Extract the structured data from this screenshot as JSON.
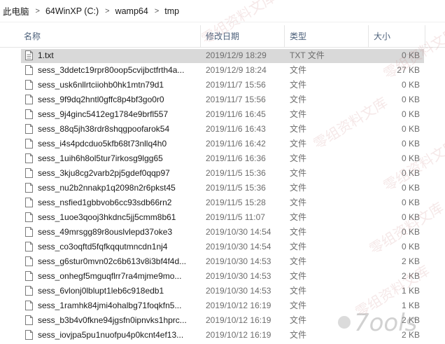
{
  "breadcrumb": [
    "此电脑",
    "64WinXP  (C:)",
    "wamp64",
    "tmp"
  ],
  "columns": {
    "name": "名称",
    "date": "修改日期",
    "type": "类型",
    "size": "大小"
  },
  "files": [
    {
      "name": "1.txt",
      "date": "2019/12/9 18:29",
      "type": "TXT 文件",
      "size": "0 KB",
      "selected": true
    },
    {
      "name": "sess_3ddetc19rpr80oop5cvijbctfrth4a...",
      "date": "2019/12/9 18:24",
      "type": "文件",
      "size": "27 KB"
    },
    {
      "name": "sess_usk6nllrtciiohb0hk1mtn79d1",
      "date": "2019/11/7 15:56",
      "type": "文件",
      "size": "0 KB"
    },
    {
      "name": "sess_9f9dq2hntl0gffc8p4bf3go0r0",
      "date": "2019/11/7 15:56",
      "type": "文件",
      "size": "0 KB"
    },
    {
      "name": "sess_9j4ginc5412eg1784e9brfl557",
      "date": "2019/11/6 16:45",
      "type": "文件",
      "size": "0 KB"
    },
    {
      "name": "sess_88q5jh38rdr8shqgpoofarok54",
      "date": "2019/11/6 16:43",
      "type": "文件",
      "size": "0 KB"
    },
    {
      "name": "sess_i4s4pdcduo5kfb68t73nllq4h0",
      "date": "2019/11/6 16:42",
      "type": "文件",
      "size": "0 KB"
    },
    {
      "name": "sess_1uih6h8ol5tur7irkosg9lgg65",
      "date": "2019/11/6 16:36",
      "type": "文件",
      "size": "0 KB"
    },
    {
      "name": "sess_3kju8cg2varb2pj5gdef0qqp97",
      "date": "2019/11/5 15:36",
      "type": "文件",
      "size": "0 KB"
    },
    {
      "name": "sess_nu2b2nnakp1q2098n2r6pkst45",
      "date": "2019/11/5 15:36",
      "type": "文件",
      "size": "0 KB"
    },
    {
      "name": "sess_nsfied1gbbvob6cc93sdb66rn2",
      "date": "2019/11/5 15:28",
      "type": "文件",
      "size": "0 KB"
    },
    {
      "name": "sess_1uoe3qooj3hkdnc5jj5cmm8b61",
      "date": "2019/11/5 11:07",
      "type": "文件",
      "size": "0 KB"
    },
    {
      "name": "sess_49mrsgg89r8ouslvlepd37oke3",
      "date": "2019/10/30 14:54",
      "type": "文件",
      "size": "0 KB"
    },
    {
      "name": "sess_co3oqftd5fqfkqqutmncdn1nj4",
      "date": "2019/10/30 14:54",
      "type": "文件",
      "size": "0 KB"
    },
    {
      "name": "sess_g6stur0mvn02c6b613v8i3bf4f4d...",
      "date": "2019/10/30 14:53",
      "type": "文件",
      "size": "2 KB"
    },
    {
      "name": "sess_onhegf5mguqflrr7ra4mjme9mo...",
      "date": "2019/10/30 14:53",
      "type": "文件",
      "size": "2 KB"
    },
    {
      "name": "sess_6vlonj0lblupt1leb6c918edb1",
      "date": "2019/10/30 14:53",
      "type": "文件",
      "size": "1 KB"
    },
    {
      "name": "sess_1ramhk84jmi4ohalbg71foqkfn5...",
      "date": "2019/10/12 16:19",
      "type": "文件",
      "size": "1 KB"
    },
    {
      "name": "sess_b3b4v0fkne94jgsfn0ipnvks1hprc...",
      "date": "2019/10/12 16:19",
      "type": "文件",
      "size": "2 KB"
    },
    {
      "name": "sess_iovjpa5pu1nuofpu4p0kcnt4ef13...",
      "date": "2019/10/12 16:19",
      "type": "文件",
      "size": "2 KB"
    }
  ],
  "watermark": "零组资料文库",
  "logo_text": "7ools",
  "colors": {
    "selected_row": "#d9d9d9",
    "header_text": "#4c607a",
    "meta_text": "#6d6d6d"
  }
}
